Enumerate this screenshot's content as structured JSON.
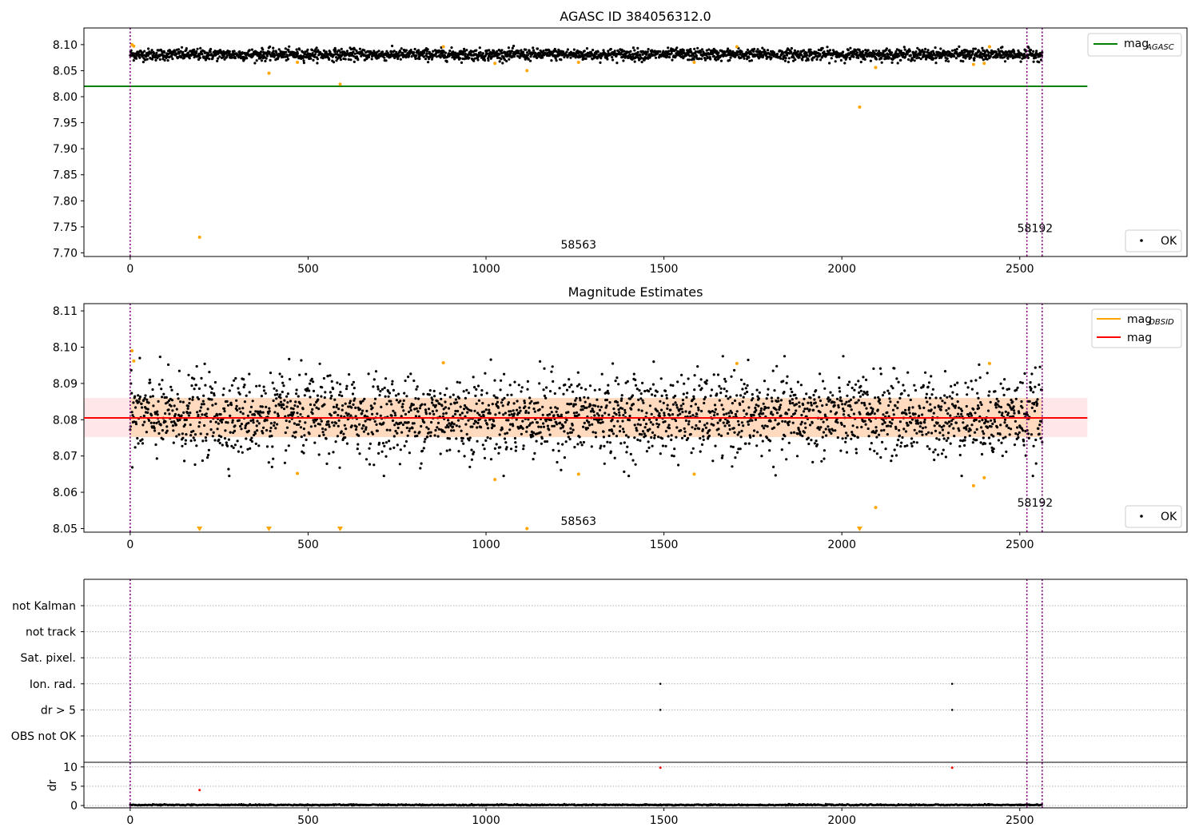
{
  "chart_data": [
    {
      "type": "scatter",
      "title": "AGASC ID 384056312.0",
      "xlim": [
        -130,
        2970
      ],
      "ylim": [
        7.693,
        8.132
      ],
      "x_ticks": [
        0,
        500,
        1000,
        1500,
        2000,
        2500
      ],
      "y_ticks": [
        7.7,
        7.75,
        7.8,
        7.85,
        7.9,
        7.95,
        8.0,
        8.05,
        8.1
      ],
      "y_tick_format": 2,
      "n_ok_points": 2560,
      "ok_center": 8.081,
      "ok_spread": 0.0055,
      "reference_line": {
        "name": "mag",
        "subscript": "AGASC",
        "value": 8.02,
        "x_range": [
          -130,
          2690
        ],
        "color": "#008000"
      },
      "vlines": [
        0,
        2520,
        2563
      ],
      "vline_color": "#800080",
      "annotations": [
        {
          "text": "58563",
          "x": 1260,
          "y": 7.708
        },
        {
          "text": "58192",
          "x": 2543,
          "y": 7.74
        }
      ],
      "outliers": {
        "color": "#ffa500",
        "points": [
          [
            5,
            8.1
          ],
          [
            10,
            8.097
          ],
          [
            195,
            7.73
          ],
          [
            390,
            8.045
          ],
          [
            470,
            8.066
          ],
          [
            590,
            8.024
          ],
          [
            880,
            8.096
          ],
          [
            1025,
            8.064
          ],
          [
            1115,
            8.05
          ],
          [
            1260,
            8.066
          ],
          [
            1585,
            8.066
          ],
          [
            1705,
            8.096
          ],
          [
            2050,
            7.98
          ],
          [
            2095,
            8.056
          ],
          [
            2370,
            8.062
          ],
          [
            2400,
            8.064
          ],
          [
            2415,
            8.096
          ]
        ]
      },
      "legend": {
        "upper": [
          {
            "label": "mag",
            "subscript": "AGASC",
            "color": "#008000",
            "marker": "line"
          }
        ],
        "lower": [
          {
            "label": "OK",
            "color": "#000000",
            "marker": "dot"
          }
        ]
      }
    },
    {
      "type": "scatter",
      "title": "Magnitude Estimates",
      "xlim": [
        -130,
        2970
      ],
      "ylim": [
        8.049,
        8.112
      ],
      "x_ticks": [
        0,
        500,
        1000,
        1500,
        2000,
        2500
      ],
      "y_ticks": [
        8.05,
        8.06,
        8.07,
        8.08,
        8.09,
        8.1,
        8.11
      ],
      "y_tick_format": 2,
      "n_ok_points": 2560,
      "ok_center": 8.081,
      "ok_spread": 0.0055,
      "reference_line": {
        "name": "mag",
        "value": 8.0805,
        "x_range": [
          -130,
          2690
        ],
        "color": "#ff0000"
      },
      "band": {
        "low": 8.0752,
        "high": 8.086,
        "x_range": [
          -130,
          2690
        ],
        "color": "#ffb6c1"
      },
      "obsid_line": {
        "name": "mag",
        "subscript": "OBSID",
        "color": "#ffa500"
      },
      "obsid_band": {
        "low": 8.0752,
        "high": 8.086,
        "x_range": [
          0,
          2563
        ],
        "color": "#ffa500"
      },
      "vlines": [
        0,
        2520,
        2563
      ],
      "vline_color": "#800080",
      "annotations": [
        {
          "text": "58563",
          "x": 1260,
          "y": 8.051
        },
        {
          "text": "58192",
          "x": 2543,
          "y": 8.056
        }
      ],
      "outliers": {
        "color": "#ffa500",
        "points": [
          [
            5,
            8.099
          ],
          [
            10,
            8.0962
          ],
          [
            470,
            8.0652
          ],
          [
            880,
            8.0957
          ],
          [
            1025,
            8.0635
          ],
          [
            1115,
            8.05
          ],
          [
            1260,
            8.065
          ],
          [
            1585,
            8.065
          ],
          [
            1705,
            8.0955
          ],
          [
            2095,
            8.0558
          ],
          [
            2370,
            8.0618
          ],
          [
            2400,
            8.064
          ],
          [
            2415,
            8.0955
          ]
        ]
      },
      "clipped": {
        "color": "#ffa500",
        "x": [
          195,
          390,
          590,
          2050
        ]
      },
      "legend": {
        "upper": [
          {
            "label": "mag",
            "subscript": "OBSID",
            "color": "#ffa500",
            "marker": "line"
          },
          {
            "label": "mag",
            "color": "#ff0000",
            "marker": "line"
          }
        ],
        "lower": [
          {
            "label": "OK",
            "color": "#000000",
            "marker": "dot"
          }
        ]
      }
    },
    {
      "type": "scatter",
      "title": "",
      "xlim": [
        -130,
        2970
      ],
      "categories": [
        "OBS not OK",
        "dr > 5",
        "Ion. rad.",
        "Sat. pixel.",
        "not track",
        "not Kalman"
      ],
      "vlines": [
        0,
        2520,
        2563
      ],
      "vline_color": "#800080",
      "flags": [
        {
          "category": "Ion. rad.",
          "x": [
            1490,
            2310
          ]
        },
        {
          "category": "dr > 5",
          "x": [
            1490,
            2310
          ]
        }
      ]
    },
    {
      "type": "scatter",
      "title": "",
      "ylabel": "dr",
      "xlim": [
        -130,
        2970
      ],
      "ylim": [
        -0.6,
        11.2
      ],
      "x_ticks": [
        0,
        500,
        1000,
        1500,
        2000,
        2500
      ],
      "y_ticks": [
        0,
        5,
        10
      ],
      "y_tick_format": 0,
      "n_points": 2560,
      "base_level": 0.15,
      "vlines": [
        0,
        2520,
        2563
      ],
      "vline_color": "#800080",
      "highlights": [
        {
          "x": 195,
          "y": 4.0,
          "color": "#ff0000"
        },
        {
          "x": 1490,
          "y": 9.8,
          "color": "#ff0000"
        },
        {
          "x": 2310,
          "y": 9.8,
          "color": "#ff0000"
        }
      ]
    }
  ]
}
